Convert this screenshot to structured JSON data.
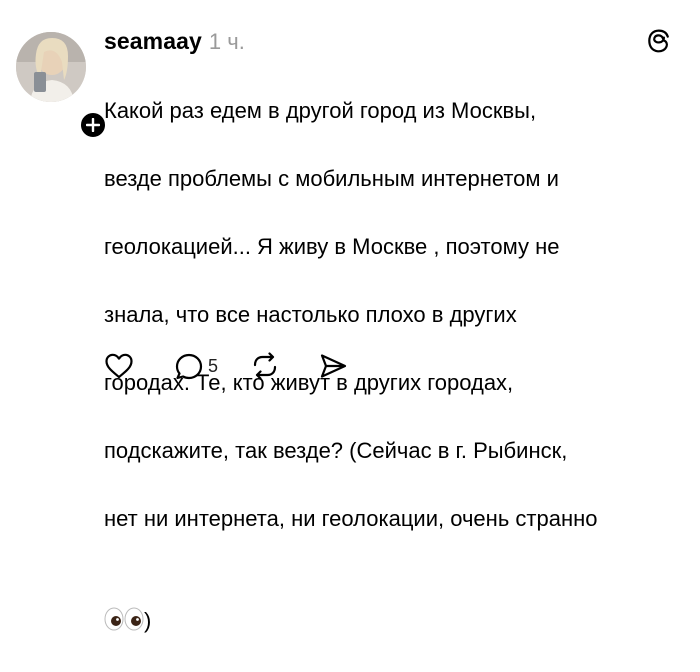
{
  "post": {
    "username": "seamaay",
    "time": "1 ч.",
    "text_lines": [
      "Какой раз едем в другой город из Москвы,",
      "везде проблемы с мобильным интернетом и",
      "геолокацией... Я живу в Москве , поэтому не",
      "знала, что все настолько плохо в других",
      "городах. Те, кто живут в других городах,",
      "подскажите, так везде? (Сейчас в г. Рыбинск,",
      "нет ни интернета, ни геолокации, очень странно"
    ],
    "text_last": ")",
    "emoji": "eyes-emoji",
    "reply_count": "5"
  },
  "icons": {
    "like": "heart-icon",
    "reply": "comment-icon",
    "repost": "repost-icon",
    "share": "send-icon",
    "follow": "plus-icon",
    "brand": "threads-logo-icon"
  },
  "colors": {
    "text": "#000000",
    "muted": "#9a9a9a",
    "background": "#ffffff"
  }
}
